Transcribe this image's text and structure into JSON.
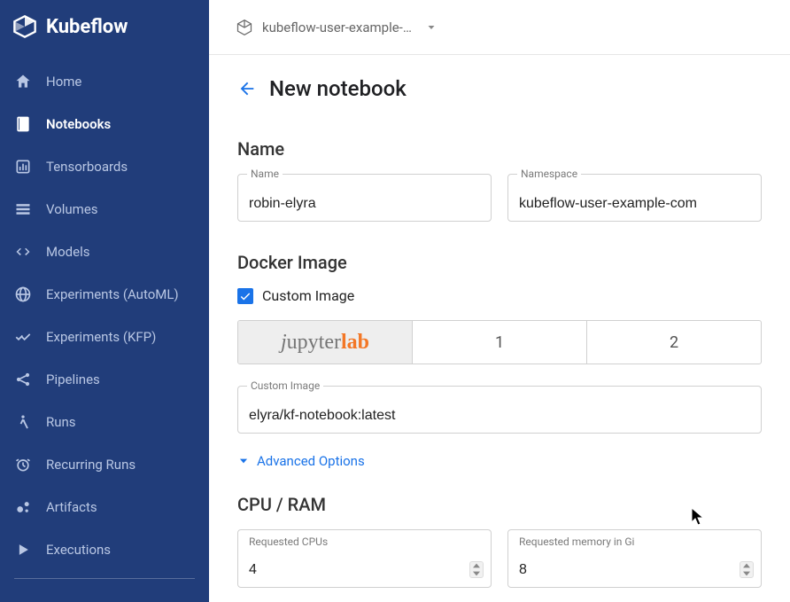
{
  "app": {
    "brand": "Kubeflow"
  },
  "sidebar": {
    "items": [
      {
        "label": "Home"
      },
      {
        "label": "Notebooks"
      },
      {
        "label": "Tensorboards"
      },
      {
        "label": "Volumes"
      },
      {
        "label": "Models"
      },
      {
        "label": "Experiments (AutoML)"
      },
      {
        "label": "Experiments (KFP)"
      },
      {
        "label": "Pipelines"
      },
      {
        "label": "Runs"
      },
      {
        "label": "Recurring Runs"
      },
      {
        "label": "Artifacts"
      },
      {
        "label": "Executions"
      }
    ]
  },
  "topbar": {
    "namespace_display": "kubeflow-user-example-c..."
  },
  "page": {
    "title": "New notebook"
  },
  "sections": {
    "name": {
      "title": "Name",
      "name_label": "Name",
      "name_value": "robin-elyra",
      "namespace_label": "Namespace",
      "namespace_value": "kubeflow-user-example-com"
    },
    "docker": {
      "title": "Docker Image",
      "custom_image_label": "Custom Image",
      "custom_image_checked": true,
      "tabs": {
        "jupyterlab": {
          "j": "j",
          "upyter": "upyter",
          "lab": "lab"
        },
        "second": "1",
        "third": "2"
      },
      "ci_field_label": "Custom Image",
      "ci_field_value": "elyra/kf-notebook:latest",
      "advanced_text": "Advanced Options"
    },
    "cpu": {
      "title": "CPU / RAM",
      "cpus_label": "Requested CPUs",
      "cpus_value": "4",
      "mem_label": "Requested memory in Gi",
      "mem_value": "8"
    }
  }
}
